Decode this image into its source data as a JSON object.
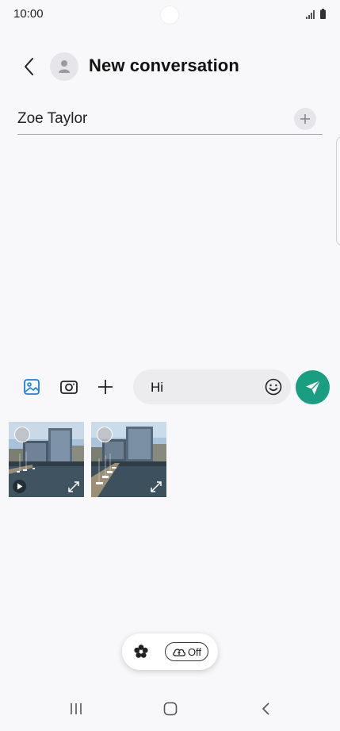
{
  "status_bar": {
    "time": "10:00",
    "icons": [
      "signal-icon",
      "battery-icon"
    ]
  },
  "header": {
    "title": "New conversation",
    "back_icon": "back-arrow-icon",
    "avatar_icon": "person-icon"
  },
  "recipient": {
    "name": "Zoe Taylor",
    "add_icon": "plus-icon"
  },
  "compose": {
    "tools": [
      "gallery-icon",
      "camera-icon",
      "plus-icon"
    ],
    "message_text": "Hi",
    "emoji_icon": "emoji-icon",
    "send_icon": "send-icon",
    "send_color": "#1a9e82"
  },
  "gallery": {
    "items": [
      {
        "type": "video",
        "subject": "harbor-buildings"
      },
      {
        "type": "image",
        "subject": "harbor-buildings"
      }
    ]
  },
  "pill": {
    "flower_icon": "bixby-flower-icon",
    "cloud_icon": "cloud-sync-icon",
    "off_label": "Off"
  },
  "nav_bar": {
    "icons": [
      "recents-icon",
      "home-icon",
      "back-icon"
    ]
  }
}
